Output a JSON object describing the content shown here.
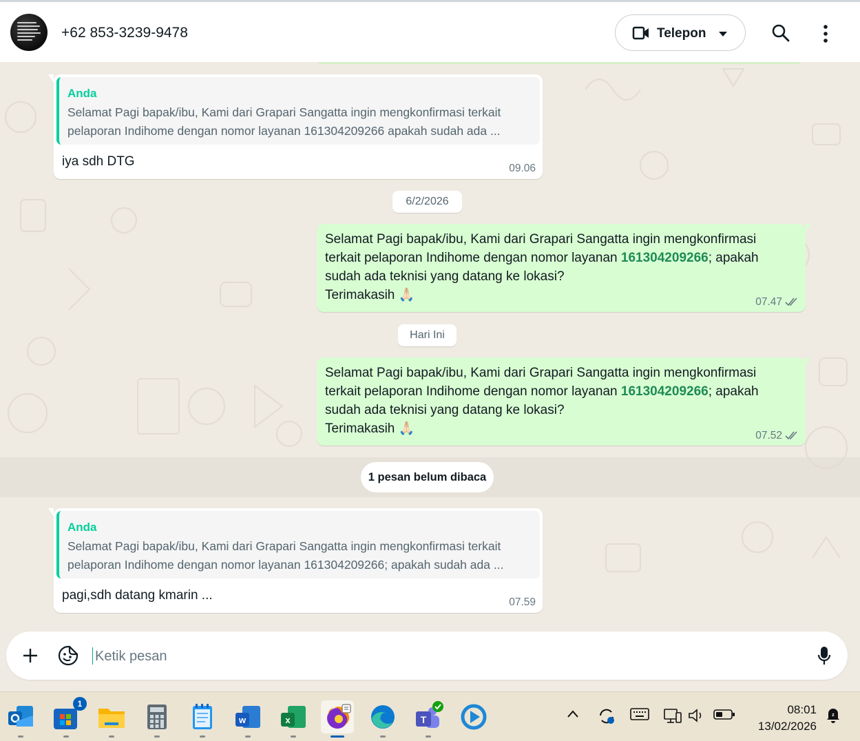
{
  "header": {
    "contact": "+62 853-3239-9478",
    "call_label": "Telepon"
  },
  "messages": [
    {
      "quote_author": "Anda",
      "quote_text": "Selamat Pagi bapak/ibu, Kami dari Grapari Sangatta ingin mengkonfirmasi terkait\npelaporan Indihome dengan nomor layanan 161304209266 apakah sudah ada ...",
      "text": "iya sdh DTG",
      "time": "09.06"
    },
    {
      "text_before": "Selamat Pagi bapak/ibu, Kami dari Grapari Sangatta ingin mengkonfirmasi\nterkait pelaporan Indihome dengan nomor layanan ",
      "number": "161304209266",
      "text_after": "; apakah\nsudah ada teknisi yang datang ke lokasi?\nTerimakasih 🙏🏻",
      "time": "07.47"
    },
    {
      "text_before": "Selamat Pagi bapak/ibu, Kami dari Grapari Sangatta ingin mengkonfirmasi\nterkait pelaporan Indihome dengan nomor layanan ",
      "number": "161304209266",
      "text_after": "; apakah\nsudah ada teknisi yang datang ke lokasi?\nTerimakasih 🙏🏻",
      "time": "07.52"
    },
    {
      "quote_author": "Anda",
      "quote_text": "Selamat Pagi bapak/ibu, Kami dari Grapari Sangatta ingin mengkonfirmasi terkait\npelaporan Indihome dengan nomor layanan 161304209266; apakah sudah ada ...",
      "text": "pagi,sdh datang kmarin ...",
      "time": "07.59"
    }
  ],
  "dividers": {
    "date1": "6/2/2026",
    "date2": "Hari Ini",
    "unread": "1 pesan belum dibaca"
  },
  "composer": {
    "placeholder": "Ketik pesan"
  },
  "taskbar": {
    "store_badge": "1",
    "time": "08:01",
    "date": "13/02/2026"
  },
  "colors": {
    "accent": "#06cf9c",
    "outgoing_bubble": "#d9fdd3",
    "chat_background": "#efeae2",
    "link_number": "#1e8b55",
    "read_ticks": "#667781"
  },
  "icons": {
    "header": [
      "video-camera-icon",
      "chevron-down-icon",
      "search-icon",
      "more-vertical-icon"
    ],
    "composer": [
      "plus-icon",
      "sticker-icon",
      "microphone-icon"
    ],
    "tray": [
      "chevron-up-icon",
      "sync-icon",
      "keyboard-icon",
      "network-icon",
      "volume-icon",
      "battery-icon",
      "do-not-disturb-icon"
    ]
  }
}
